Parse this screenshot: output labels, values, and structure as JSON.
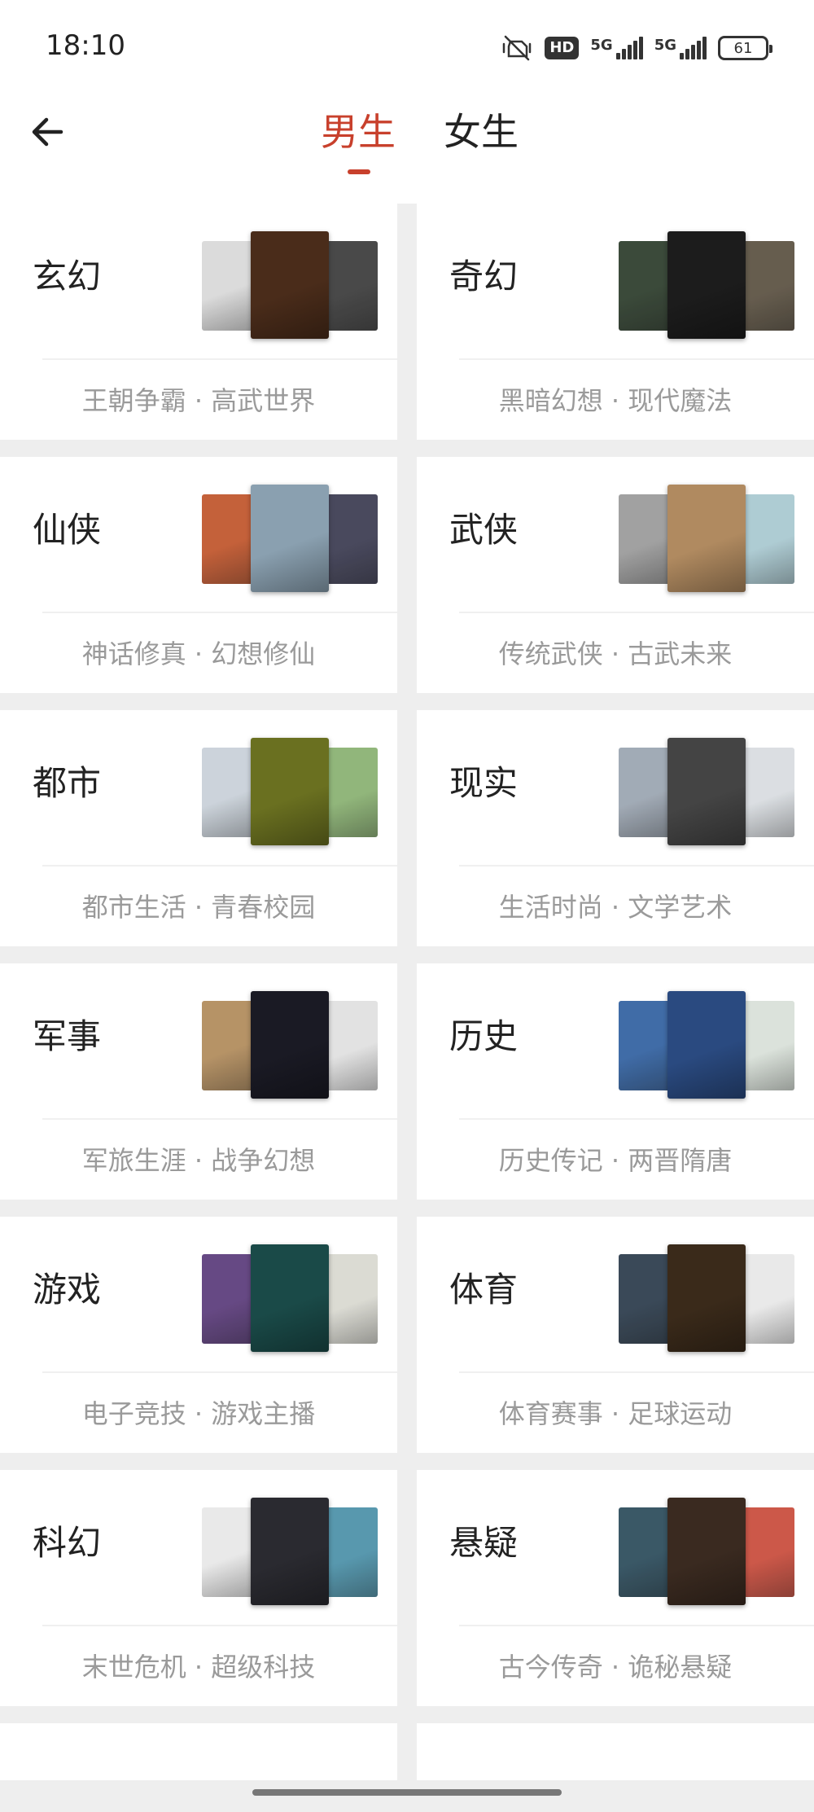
{
  "status_bar": {
    "time": "18:10",
    "hd_label": "HD",
    "network_1": "5G",
    "network_2": "5G",
    "battery": "61"
  },
  "nav": {
    "tab_male": "男生",
    "tab_female": "女生",
    "selected_tab": "男生"
  },
  "categories": [
    {
      "name": "玄幻",
      "tags": "王朝争霸 · 高武世界",
      "covers": [
        "#d8d8d8",
        "#4a2c1a",
        "#3a3a3a"
      ]
    },
    {
      "name": "奇幻",
      "tags": "黑暗幻想 · 现代魔法",
      "covers": [
        "#2b3b2a",
        "#1c1c1c",
        "#5a5040"
      ]
    },
    {
      "name": "仙侠",
      "tags": "神话修真 · 幻想修仙",
      "covers": [
        "#c0542a",
        "#8aa0b0",
        "#3a3a50"
      ]
    },
    {
      "name": "武侠",
      "tags": "传统武侠 · 古武未来",
      "covers": [
        "#9a9a9a",
        "#b08a60",
        "#a8c8d0"
      ]
    },
    {
      "name": "都市",
      "tags": "都市生活 · 青春校园",
      "covers": [
        "#c8d0d8",
        "#6a7020",
        "#88b070"
      ]
    },
    {
      "name": "现实",
      "tags": "生活时尚 · 文学艺术",
      "covers": [
        "#9aa4b0",
        "#444444",
        "#d8dce0"
      ]
    },
    {
      "name": "军事",
      "tags": "军旅生涯 · 战争幻想",
      "covers": [
        "#b08a5a",
        "#1a1a24",
        "#e0e0e0"
      ]
    },
    {
      "name": "历史",
      "tags": "历史传记 · 两晋隋唐",
      "covers": [
        "#3060a0",
        "#2a4a80",
        "#d8e0d8"
      ]
    },
    {
      "name": "游戏",
      "tags": "电子竞技 · 游戏主播",
      "covers": [
        "#5a3a7a",
        "#1a4a48",
        "#d8d8d0"
      ]
    },
    {
      "name": "体育",
      "tags": "体育赛事 · 足球运动",
      "covers": [
        "#2a3a4a",
        "#3a2a1a",
        "#e8e8e8"
      ]
    },
    {
      "name": "科幻",
      "tags": "末世危机 · 超级科技",
      "covers": [
        "#e8e8e8",
        "#2a2a30",
        "#4a90a8"
      ]
    },
    {
      "name": "悬疑",
      "tags": "古今传奇 · 诡秘悬疑",
      "covers": [
        "#2a4a5a",
        "#3a2a20",
        "#c84a3a"
      ]
    }
  ]
}
